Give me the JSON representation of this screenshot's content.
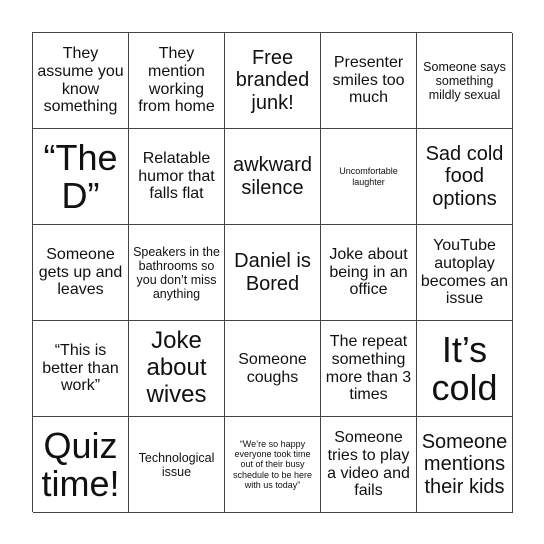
{
  "board": {
    "cells": [
      "They assume you know something",
      "They mention working from home",
      "Free branded junk!",
      "Presenter smiles too much",
      "Someone says something mildly sexual",
      "“The D”",
      "Relatable humor that falls flat",
      "awkward silence",
      "Uncomfortable laughter",
      "Sad cold food options",
      "Someone gets up and leaves",
      "Speakers in the bathrooms so you don’t miss anything",
      "Daniel is Bored",
      "Joke about being in an office",
      "YouTube autoplay becomes an issue",
      "“This is better than work”",
      "Joke about wives",
      "Someone coughs",
      "The repeat something more than 3 times",
      "It’s cold",
      "Quiz time!",
      "Technological issue",
      "“We’re so happy everyone took time out of their busy schedule to be here with us today”",
      "Someone tries to play a video and fails",
      "Someone mentions their kids"
    ]
  }
}
